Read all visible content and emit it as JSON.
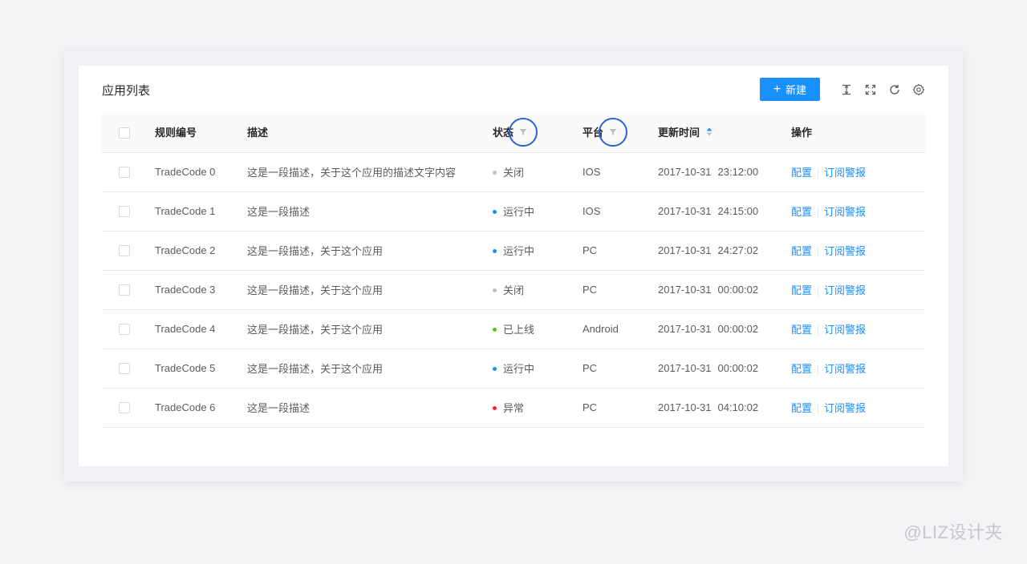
{
  "card": {
    "title": "应用列表"
  },
  "toolbar": {
    "new_label": "新建"
  },
  "columns": {
    "code": "规则编号",
    "desc": "描述",
    "status": "状态",
    "platform": "平台",
    "time": "更新时间",
    "actions": "操作"
  },
  "status_colors": {
    "关闭": "#bfbfbf",
    "运行中": "#1890ff",
    "已上线": "#52c41a",
    "异常": "#f5222d"
  },
  "rows": [
    {
      "code": "TradeCode 0",
      "desc": "这是一段描述，关于这个应用的描述文字内容",
      "status": "关闭",
      "platform": "IOS",
      "date": "2017-10-31",
      "time": "23:12:00",
      "action1": "配置",
      "action2": "订阅警报"
    },
    {
      "code": "TradeCode 1",
      "desc": "这是一段描述",
      "status": "运行中",
      "platform": "IOS",
      "date": "2017-10-31",
      "time": "24:15:00",
      "action1": "配置",
      "action2": "订阅警报"
    },
    {
      "code": "TradeCode 2",
      "desc": "这是一段描述，关于这个应用",
      "status": "运行中",
      "platform": "PC",
      "date": "2017-10-31",
      "time": "24:27:02",
      "action1": "配置",
      "action2": "订阅警报"
    },
    {
      "code": "TradeCode 3",
      "desc": "这是一段描述，关于这个应用",
      "status": "关闭",
      "platform": "PC",
      "date": "2017-10-31",
      "time": "00:00:02",
      "action1": "配置",
      "action2": "订阅警报"
    },
    {
      "code": "TradeCode 4",
      "desc": "这是一段描述，关于这个应用",
      "status": "已上线",
      "platform": "Android",
      "date": "2017-10-31",
      "time": "00:00:02",
      "action1": "配置",
      "action2": "订阅警报"
    },
    {
      "code": "TradeCode 5",
      "desc": "这是一段描述，关于这个应用",
      "status": "运行中",
      "platform": "PC",
      "date": "2017-10-31",
      "time": "00:00:02",
      "action1": "配置",
      "action2": "订阅警报"
    },
    {
      "code": "TradeCode 6",
      "desc": "这是一段描述",
      "status": "异常",
      "platform": "PC",
      "date": "2017-10-31",
      "time": "04:10:02",
      "action1": "配置",
      "action2": "订阅警报"
    }
  ],
  "watermark": "@LIZ设计夹"
}
